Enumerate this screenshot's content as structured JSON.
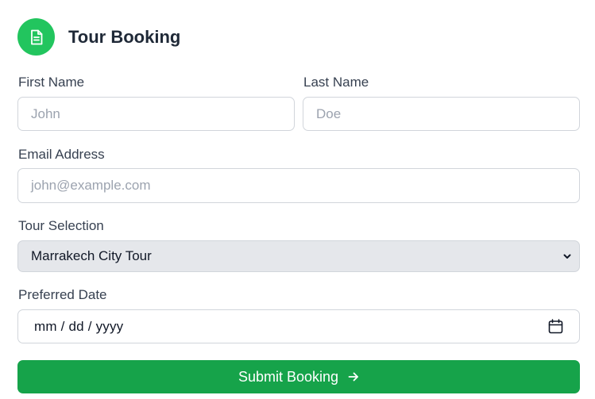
{
  "header": {
    "title": "Tour Booking",
    "icon": "document-icon",
    "accent": "#22c55e"
  },
  "form": {
    "first_name": {
      "label": "First Name",
      "placeholder": "John"
    },
    "last_name": {
      "label": "Last Name",
      "placeholder": "Doe"
    },
    "email": {
      "label": "Email Address",
      "placeholder": "john@example.com"
    },
    "tour": {
      "label": "Tour Selection",
      "value": "Marrakech City Tour",
      "icon": "chevron-down-icon"
    },
    "date": {
      "label": "Preferred Date",
      "value": "mm / dd / yyyy",
      "icon": "calendar-icon"
    },
    "submit": {
      "label": "Submit Booking",
      "icon": "arrow-right-icon",
      "color": "#16a34a"
    }
  }
}
